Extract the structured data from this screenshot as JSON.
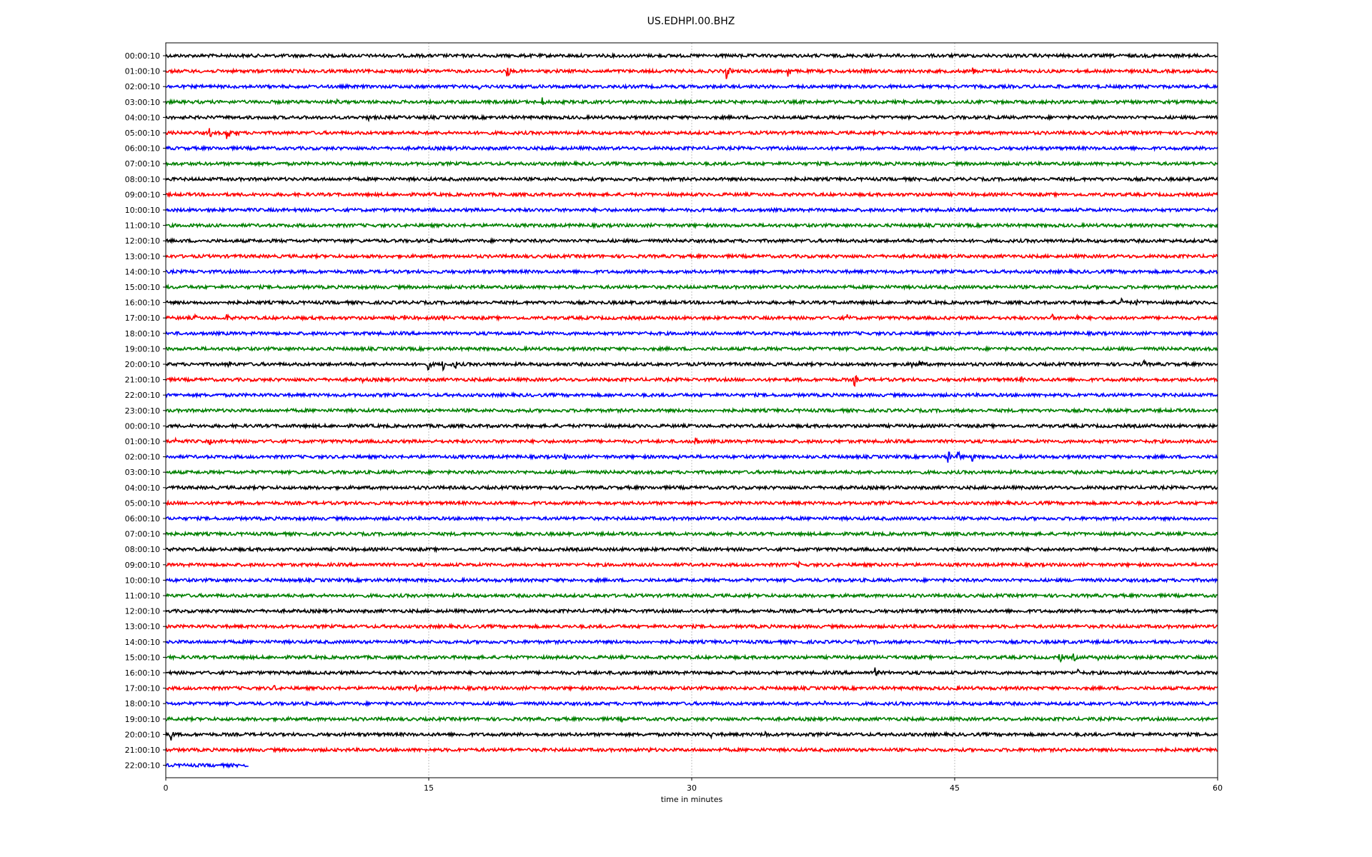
{
  "chart_data": {
    "type": "line",
    "title": "US.EDHPI.00.BHZ",
    "xlabel": "time in minutes",
    "ylabel": "",
    "xlim": [
      0,
      60
    ],
    "xticks": [
      "0",
      "15",
      "30",
      "45",
      "60"
    ],
    "xtick_values": [
      0,
      15,
      30,
      45,
      60
    ],
    "grid": "vertical dotted at x ticks",
    "colors": [
      "#000000",
      "#ff0000",
      "#0000ff",
      "#008000"
    ],
    "row_labels": [
      "00:00:10",
      "01:00:10",
      "02:00:10",
      "03:00:10",
      "04:00:10",
      "05:00:10",
      "06:00:10",
      "07:00:10",
      "08:00:10",
      "09:00:10",
      "10:00:10",
      "11:00:10",
      "12:00:10",
      "13:00:10",
      "14:00:10",
      "15:00:10",
      "16:00:10",
      "17:00:10",
      "18:00:10",
      "19:00:10",
      "20:00:10",
      "21:00:10",
      "22:00:10",
      "23:00:10",
      "00:00:10",
      "01:00:10",
      "02:00:10",
      "03:00:10",
      "04:00:10",
      "05:00:10",
      "06:00:10",
      "07:00:10",
      "08:00:10",
      "09:00:10",
      "10:00:10",
      "11:00:10",
      "12:00:10",
      "13:00:10",
      "14:00:10",
      "15:00:10",
      "16:00:10",
      "17:00:10",
      "18:00:10",
      "19:00:10",
      "20:00:10",
      "21:00:10",
      "22:00:10"
    ],
    "last_row_end_minute": 4.7,
    "events": [
      {
        "row": 0,
        "minute": 32.8,
        "amp": 4
      },
      {
        "row": 1,
        "minute": 19.5,
        "amp": 10
      },
      {
        "row": 1,
        "minute": 25,
        "amp": 6
      },
      {
        "row": 1,
        "minute": 32,
        "amp": 12
      },
      {
        "row": 1,
        "minute": 35.5,
        "amp": 10
      },
      {
        "row": 1,
        "minute": 46,
        "amp": 8
      },
      {
        "row": 2,
        "minute": 17.9,
        "amp": 5
      },
      {
        "row": 2,
        "minute": 51,
        "amp": 5
      },
      {
        "row": 3,
        "minute": 9.8,
        "amp": 4
      },
      {
        "row": 3,
        "minute": 21.5,
        "amp": 7
      },
      {
        "row": 3,
        "minute": 42.8,
        "amp": 4
      },
      {
        "row": 4,
        "minute": 11.6,
        "amp": 5
      },
      {
        "row": 5,
        "minute": 2.5,
        "amp": 8
      },
      {
        "row": 5,
        "minute": 3.5,
        "amp": 12
      },
      {
        "row": 5,
        "minute": 4,
        "amp": 7
      },
      {
        "row": 16,
        "minute": 54.5,
        "amp": 12
      },
      {
        "row": 16,
        "minute": 55.3,
        "amp": 7
      },
      {
        "row": 17,
        "minute": 1.7,
        "amp": 5
      },
      {
        "row": 17,
        "minute": 3.5,
        "amp": 6
      },
      {
        "row": 17,
        "minute": 13.6,
        "amp": 6
      },
      {
        "row": 17,
        "minute": 15.8,
        "amp": 6
      },
      {
        "row": 17,
        "minute": 38.9,
        "amp": 6
      },
      {
        "row": 17,
        "minute": 50.6,
        "amp": 6
      },
      {
        "row": 17,
        "minute": 52,
        "amp": 5
      },
      {
        "row": 20,
        "minute": 3.6,
        "amp": 6
      },
      {
        "row": 20,
        "minute": 15,
        "amp": 8
      },
      {
        "row": 20,
        "minute": 15.8,
        "amp": 10
      },
      {
        "row": 20,
        "minute": 16.5,
        "amp": 8
      },
      {
        "row": 20,
        "minute": 42.6,
        "amp": 7
      },
      {
        "row": 20,
        "minute": 43,
        "amp": 9
      },
      {
        "row": 20,
        "minute": 55.8,
        "amp": 6
      },
      {
        "row": 21,
        "minute": 11.2,
        "amp": 6
      },
      {
        "row": 21,
        "minute": 39.3,
        "amp": 9
      },
      {
        "row": 21,
        "minute": 48.8,
        "amp": 5
      },
      {
        "row": 23,
        "minute": 20.5,
        "amp": 4
      },
      {
        "row": 24,
        "minute": 15.9,
        "amp": 5
      },
      {
        "row": 25,
        "minute": 0.6,
        "amp": 5
      },
      {
        "row": 25,
        "minute": 2.5,
        "amp": 6
      },
      {
        "row": 25,
        "minute": 30.2,
        "amp": 9
      },
      {
        "row": 26,
        "minute": 22.8,
        "amp": 5
      },
      {
        "row": 26,
        "minute": 29.2,
        "amp": 5
      },
      {
        "row": 26,
        "minute": 44.6,
        "amp": 12
      },
      {
        "row": 26,
        "minute": 45.2,
        "amp": 14
      },
      {
        "row": 26,
        "minute": 46,
        "amp": 8
      },
      {
        "row": 33,
        "minute": 36.1,
        "amp": 5
      },
      {
        "row": 39,
        "minute": 51,
        "amp": 9
      },
      {
        "row": 39,
        "minute": 51.8,
        "amp": 7
      },
      {
        "row": 39,
        "minute": 53.2,
        "amp": 5
      },
      {
        "row": 39,
        "minute": 56.8,
        "amp": 4
      },
      {
        "row": 40,
        "minute": 26,
        "amp": 5
      },
      {
        "row": 40,
        "minute": 40.5,
        "amp": 8
      },
      {
        "row": 40,
        "minute": 52,
        "amp": 6
      },
      {
        "row": 41,
        "minute": 6.2,
        "amp": 5
      },
      {
        "row": 41,
        "minute": 14.3,
        "amp": 6
      },
      {
        "row": 41,
        "minute": 45.1,
        "amp": 5
      },
      {
        "row": 42,
        "minute": 37.6,
        "amp": 5
      },
      {
        "row": 42,
        "minute": 47,
        "amp": 5
      },
      {
        "row": 43,
        "minute": 26,
        "amp": 5
      },
      {
        "row": 44,
        "minute": 0.3,
        "amp": 10
      },
      {
        "row": 44,
        "minute": 31.1,
        "amp": 6
      },
      {
        "row": 44,
        "minute": 34.2,
        "amp": 7
      },
      {
        "row": 45,
        "minute": 27.6,
        "amp": 4
      }
    ]
  }
}
